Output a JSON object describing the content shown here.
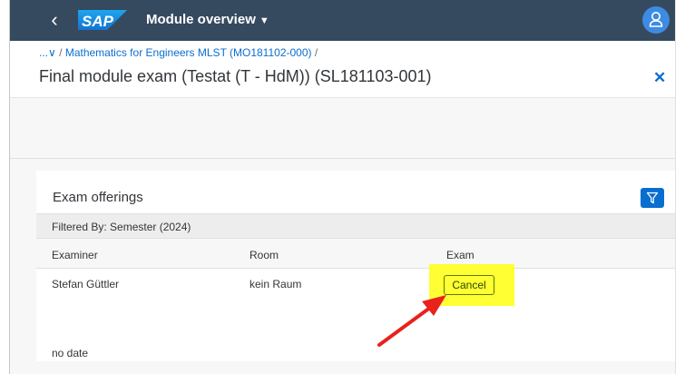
{
  "shell": {
    "logo_text": "SAP",
    "app_title": "Module overview",
    "title_caret": "▼",
    "back_glyph": "‹",
    "icons": [
      "back-icon",
      "sap-logo",
      "chevron-down-icon",
      "user-icon"
    ],
    "colors": {
      "shell_bg": "#354a5f",
      "avatar_bg": "#3d8be2"
    }
  },
  "header": {
    "breadcrumb_overflow": "...∨",
    "breadcrumb_separator": "/",
    "breadcrumb_link": "Mathematics for Engineers MLST (MO181102-000)",
    "breadcrumb_trailing_separator": "/",
    "title": "Final module exam (Testat (T - HdM)) (SL181103-001)",
    "close_glyph": "✕",
    "colors": {
      "link": "#0a6ed1"
    }
  },
  "panel": {
    "title": "Exam offerings",
    "filter_icon": "filter-icon",
    "filter_text": "Filtered By: Semester (2024)",
    "columns": [
      "Examiner",
      "Room",
      "Exam"
    ],
    "rows": [
      {
        "examiner": "Stefan Güttler",
        "room": "kein Raum",
        "exam_action": "Cancel",
        "date": "no date"
      }
    ]
  },
  "annotation": {
    "highlight_color": "#ffff33",
    "arrow_color": "#e8221c"
  }
}
